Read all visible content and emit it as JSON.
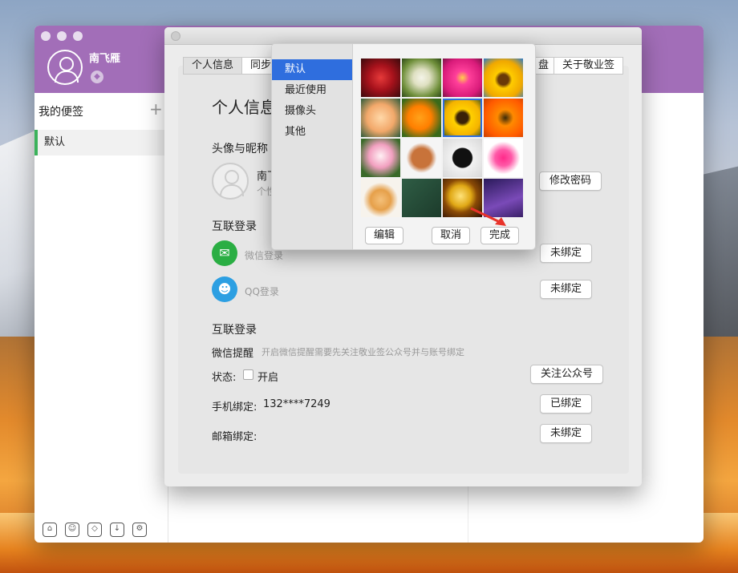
{
  "app": {
    "user_name": "南飞雁",
    "sidebar_title": "我的便签",
    "sidebar_add": "+",
    "sidebar_items": [
      {
        "label": "默认"
      }
    ]
  },
  "settings": {
    "tabs_left": [
      {
        "label": "个人信息"
      },
      {
        "label": "同步"
      }
    ],
    "tabs_right": [
      {
        "label": "盘"
      },
      {
        "label": "关于敬业签"
      }
    ],
    "page_title": "个人信息",
    "avatar_section": "头像与昵称",
    "nickname_partial": "南飞",
    "signature_partial": "个性",
    "change_password": "修改密码",
    "link_section": "互联登录",
    "wechat_login": "微信登录",
    "qq_login": "QQ登录",
    "unbound": "未绑定",
    "reminder_section": "互联登录",
    "wechat_reminder_label": "微信提醒",
    "wechat_reminder_hint": "开启微信提醒需要先关注敬业签公众号并与账号绑定",
    "status_label": "状态:",
    "status_option": "开启",
    "follow_button": "关注公众号",
    "phone_label": "手机绑定:",
    "phone_value": "132****7249",
    "phone_status": "已绑定",
    "email_label": "邮箱绑定:",
    "email_status": "未绑定"
  },
  "picker": {
    "categories": [
      {
        "label": "默认"
      },
      {
        "label": "最近使用"
      },
      {
        "label": "摄像头"
      },
      {
        "label": "其他"
      }
    ],
    "selected_category": "默认",
    "images": [
      "red-rose",
      "dandelion",
      "pink-daisy",
      "sunflower",
      "peach-rose",
      "orange-poppy",
      "yellow-daisy",
      "orange-gerbera",
      "lotus",
      "gingerbread-man",
      "yin-yang",
      "lips",
      "fortune-cookie",
      "chalkboard",
      "gold-coin",
      "lightning"
    ],
    "edit_button": "编辑",
    "cancel_button": "取消",
    "done_button": "完成"
  },
  "colors": {
    "accent": "#a26eb8",
    "selection": "#2f6ede",
    "wechat": "#2aae43",
    "qq": "#2c9fe2",
    "active_bar": "#3bb25b"
  }
}
